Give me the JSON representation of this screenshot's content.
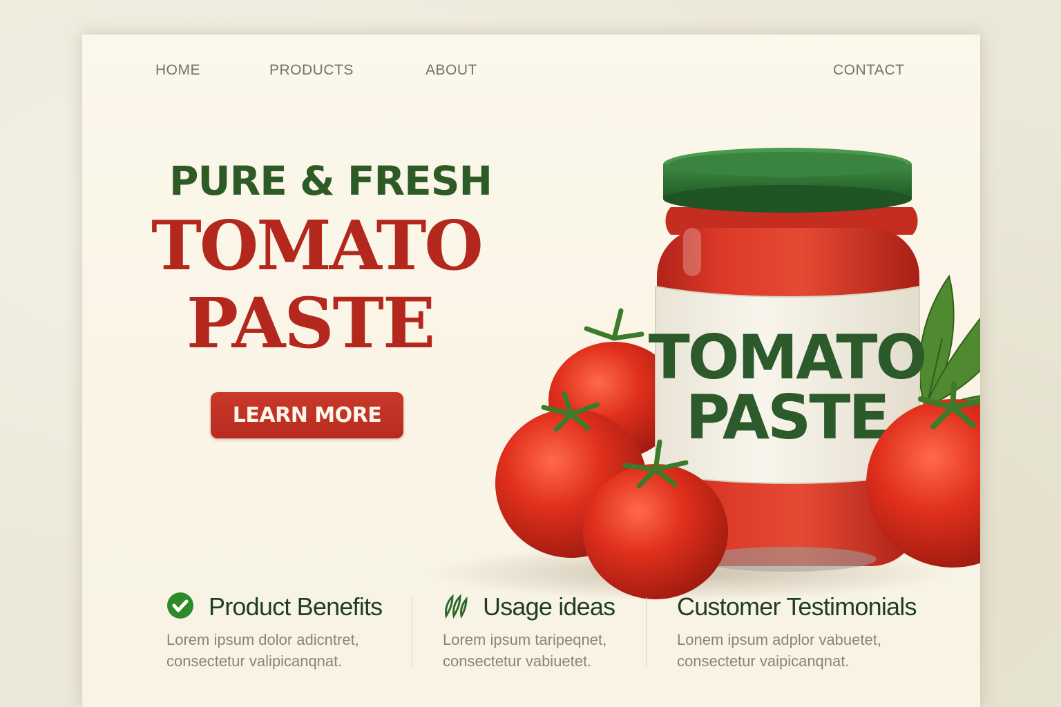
{
  "nav": {
    "items": [
      {
        "label": "HOME"
      },
      {
        "label": "PRODUCTS"
      },
      {
        "label": "ABOUT"
      },
      {
        "label": "CONTACT"
      }
    ]
  },
  "hero": {
    "tagline": "PURE & FRESH",
    "title_line1": "TOMATO",
    "title_line2": "PASTE",
    "cta_label": "LEARN MORE"
  },
  "product": {
    "label_line1": "TOMATO",
    "label_line2": "PASTE",
    "image": "tomato-paste-jar-with-fresh-tomatoes"
  },
  "features": [
    {
      "icon": "check-circle-icon",
      "title": "Product Benefits",
      "text": "Lorem ipsum dolor adicntret, consectetur valipicanqnat."
    },
    {
      "icon": "herb-leaves-icon",
      "title": "Usage ideas",
      "text": "Lorem ipsum taripeqnet, consectetur vabiuetet."
    },
    {
      "icon": "",
      "title": "Customer Testimonials",
      "text": "Lonem ipsum adplor vabuetet, consectetur vaipicanqnat."
    }
  ],
  "colors": {
    "brand_red": "#b3271d",
    "brand_green": "#2e5a25",
    "cta_red": "#c23226",
    "background_cream": "#fbf7ea",
    "nav_gray": "#777166",
    "body_text_gray": "#8a8478"
  }
}
